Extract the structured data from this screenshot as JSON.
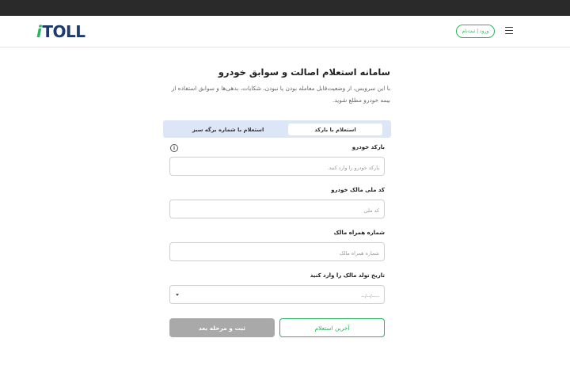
{
  "header": {
    "logo_mark": "i",
    "logo_text": "TOLL",
    "login_label": "ورود | ثبت‌نام"
  },
  "page": {
    "title": "سامانه استعلام اصالت و سوابق خودرو",
    "description": "با این سرویس، از وضعیت‌قابل معامله بودن یا نبودن، شکایات، بدهی‌ها و سوابق استفاده از بیمه خودرو مطلع شوید."
  },
  "tabs": [
    {
      "label": "استعلام با بارکد",
      "active": true
    },
    {
      "label": "استعلام با شماره برگه سبز",
      "active": false
    }
  ],
  "form": {
    "barcode": {
      "label": "بارکد خودرو",
      "placeholder": "بارکد خودرو را وارد کنید.",
      "value": ""
    },
    "national_code": {
      "label": "کد ملی مالک خودرو",
      "placeholder": "کد ملی",
      "value": ""
    },
    "mobile": {
      "label": "شماره همراه مالک",
      "placeholder": "شماره همراه مالک",
      "value": ""
    },
    "birth_date": {
      "label": "تاریخ تولد مالک را وارد کنید",
      "placeholder": "----/--/--",
      "value": ""
    }
  },
  "buttons": {
    "history": "آخرین استعلام",
    "submit": "ثبت و مرحله بعد"
  },
  "colors": {
    "brand_green": "#2eb362",
    "brand_navy": "#1f3b6e",
    "tab_bg": "#dde6f7",
    "disabled_btn": "#a9a9a9"
  },
  "icons": {
    "info": "i"
  }
}
